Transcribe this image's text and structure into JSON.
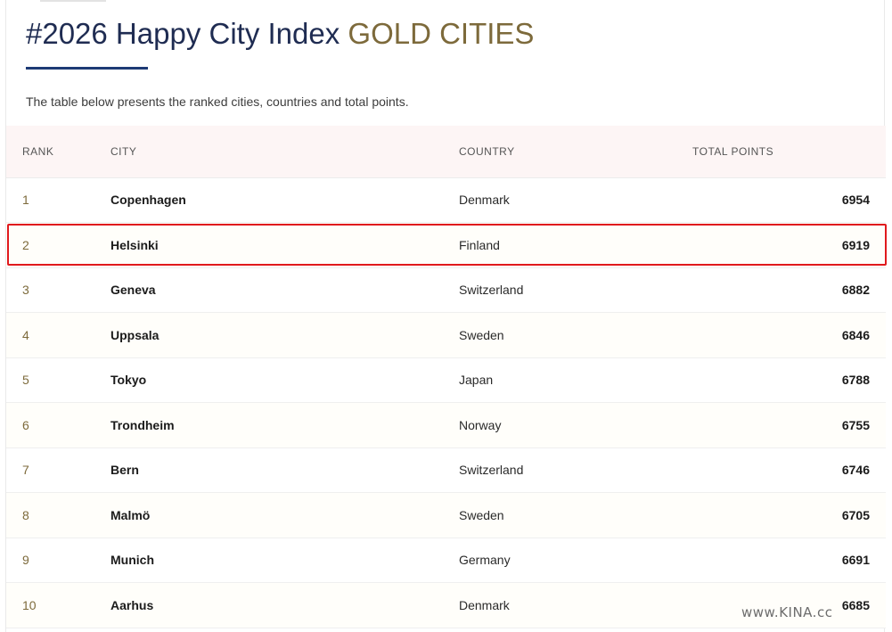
{
  "header": {
    "title_main": "#2026 Happy City Index",
    "title_accent": "GOLD CITIES",
    "intro": "The table below presents the ranked cities, countries and total points."
  },
  "table": {
    "columns": [
      "RANK",
      "CITY",
      "COUNTRY",
      "TOTAL POINTS"
    ],
    "rows": [
      {
        "rank": "1",
        "city": "Copenhagen",
        "country": "Denmark",
        "points": "6954"
      },
      {
        "rank": "2",
        "city": "Helsinki",
        "country": "Finland",
        "points": "6919"
      },
      {
        "rank": "3",
        "city": "Geneva",
        "country": "Switzerland",
        "points": "6882"
      },
      {
        "rank": "4",
        "city": "Uppsala",
        "country": "Sweden",
        "points": "6846"
      },
      {
        "rank": "5",
        "city": "Tokyo",
        "country": "Japan",
        "points": "6788"
      },
      {
        "rank": "6",
        "city": "Trondheim",
        "country": "Norway",
        "points": "6755"
      },
      {
        "rank": "7",
        "city": "Bern",
        "country": "Switzerland",
        "points": "6746"
      },
      {
        "rank": "8",
        "city": "Malmö",
        "country": "Sweden",
        "points": "6705"
      },
      {
        "rank": "9",
        "city": "Munich",
        "country": "Germany",
        "points": "6691"
      },
      {
        "rank": "10",
        "city": "Aarhus",
        "country": "Denmark",
        "points": "6685"
      }
    ],
    "highlighted_rank": "2"
  },
  "watermark": "www.KINA.cc",
  "colors": {
    "title_main": "#1f2c52",
    "title_accent": "#7d6a3b",
    "underline": "#1d3a75",
    "header_row_bg": "#fdf5f5",
    "highlight_border": "#e0191d"
  }
}
